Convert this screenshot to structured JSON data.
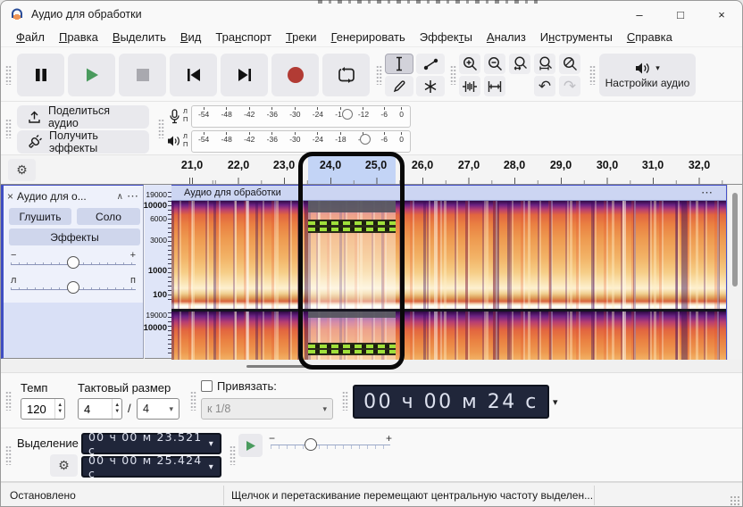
{
  "window": {
    "title": "Аудио для обработки",
    "minimize": "–",
    "maximize": "□",
    "close": "×"
  },
  "menu": {
    "items_html": [
      "<u>Ф</u>айл",
      "<u>П</u>равка",
      "<u>В</u>ыделить",
      "<u>В</u>ид",
      "Тра<u>н</u>спорт",
      "<u>Т</u>реки",
      "<u>Г</u>енерировать",
      "Эффек<u>т</u>ы",
      "<u>А</u>нализ",
      "И<u>н</u>струменты",
      "<u>С</u>правка"
    ]
  },
  "toolbar": {
    "audio_setup_label": "Настройки аудио",
    "share_audio_label": "Поделиться аудио",
    "get_effects_label": "Получить эффекты",
    "undo_icon": "↶",
    "redo_icon": "↷"
  },
  "meters": {
    "scale": [
      "-54",
      "-48",
      "-42",
      "-36",
      "-30",
      "-24",
      "-18",
      "-12",
      "-6",
      "0"
    ],
    "left_label": "Л",
    "right_label": "П"
  },
  "timeline": {
    "gear_icon": "⚙",
    "ticks": [
      "21,0",
      "22,0",
      "23,0",
      "24,0",
      "25,0",
      "26,0",
      "27,0",
      "28,0",
      "29,0",
      "30,0",
      "31,0",
      "32,0"
    ]
  },
  "track": {
    "close_icon": "×",
    "name_truncated": "Аудио для о...",
    "collapse_icon": "∧",
    "menu_icon": "⋯",
    "mute_label": "Глушить",
    "solo_label": "Соло",
    "effects_label": "Эффекты",
    "gain_minus": "−",
    "gain_plus": "+",
    "pan_left": "л",
    "pan_right": "п",
    "clip_name": "Аудио для обработки",
    "clip_menu_icon": "⋯",
    "freq_ch1": [
      "19000",
      "10000",
      "6000",
      "3000",
      "1000",
      "100"
    ],
    "freq_ch2": [
      "19000",
      "10000"
    ]
  },
  "time_toolbar": {
    "tempo_label": "Темп",
    "tempo_value": "120",
    "time_sig_label": "Тактовый размер",
    "beats_value": "4",
    "divider": "/",
    "beat_unit": "4",
    "snap_label": "Привязать:",
    "snap_value": "к 1/8",
    "position": "00 ч 00 м 24 с",
    "caret": "▾",
    "spin_up": "▲",
    "spin_down": "▼"
  },
  "selection_toolbar": {
    "label": "Выделение",
    "gear_icon": "⚙",
    "start": "00 ч 00 м 23.521 с",
    "end": "00 ч 00 м 25.424 с",
    "caret": "▾",
    "speed_minus": "−",
    "speed_plus": "+"
  },
  "status": {
    "state": "Остановлено",
    "hint": "Щелчок и перетаскивание перемещают центральную частоту выделен..."
  },
  "colors": {
    "accent_blue_border": "#3f4ec2",
    "selection_ruler": "#c3d4f6",
    "play_green": "#4a9b5e",
    "record_red": "#b23b34",
    "time_display_bg": "#20263a",
    "spectrogram_hot": "#ea8142",
    "spectral_marker_green": "#9fe03a"
  }
}
